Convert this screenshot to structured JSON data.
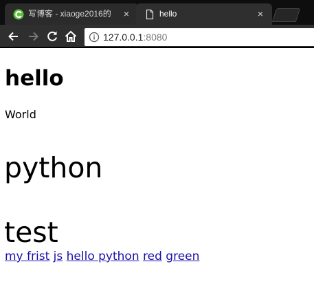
{
  "browser": {
    "tabs": [
      {
        "title": "写博客 - xiaoge2016的",
        "close": "×",
        "favicon": "csdn-icon",
        "active": false
      },
      {
        "title": "hello",
        "close": "×",
        "favicon": "page-icon",
        "active": true
      }
    ],
    "address": {
      "host": "127.0.0.1",
      "port": ":8080"
    },
    "nav": [
      "back-icon",
      "forward-icon",
      "reload-icon",
      "home-icon",
      "info-icon"
    ]
  },
  "page": {
    "heading": "hello",
    "paragraph": "World",
    "python_text": "python",
    "test_text": "test",
    "links": [
      "my frist",
      "js",
      "hello python",
      "red",
      "green"
    ]
  }
}
